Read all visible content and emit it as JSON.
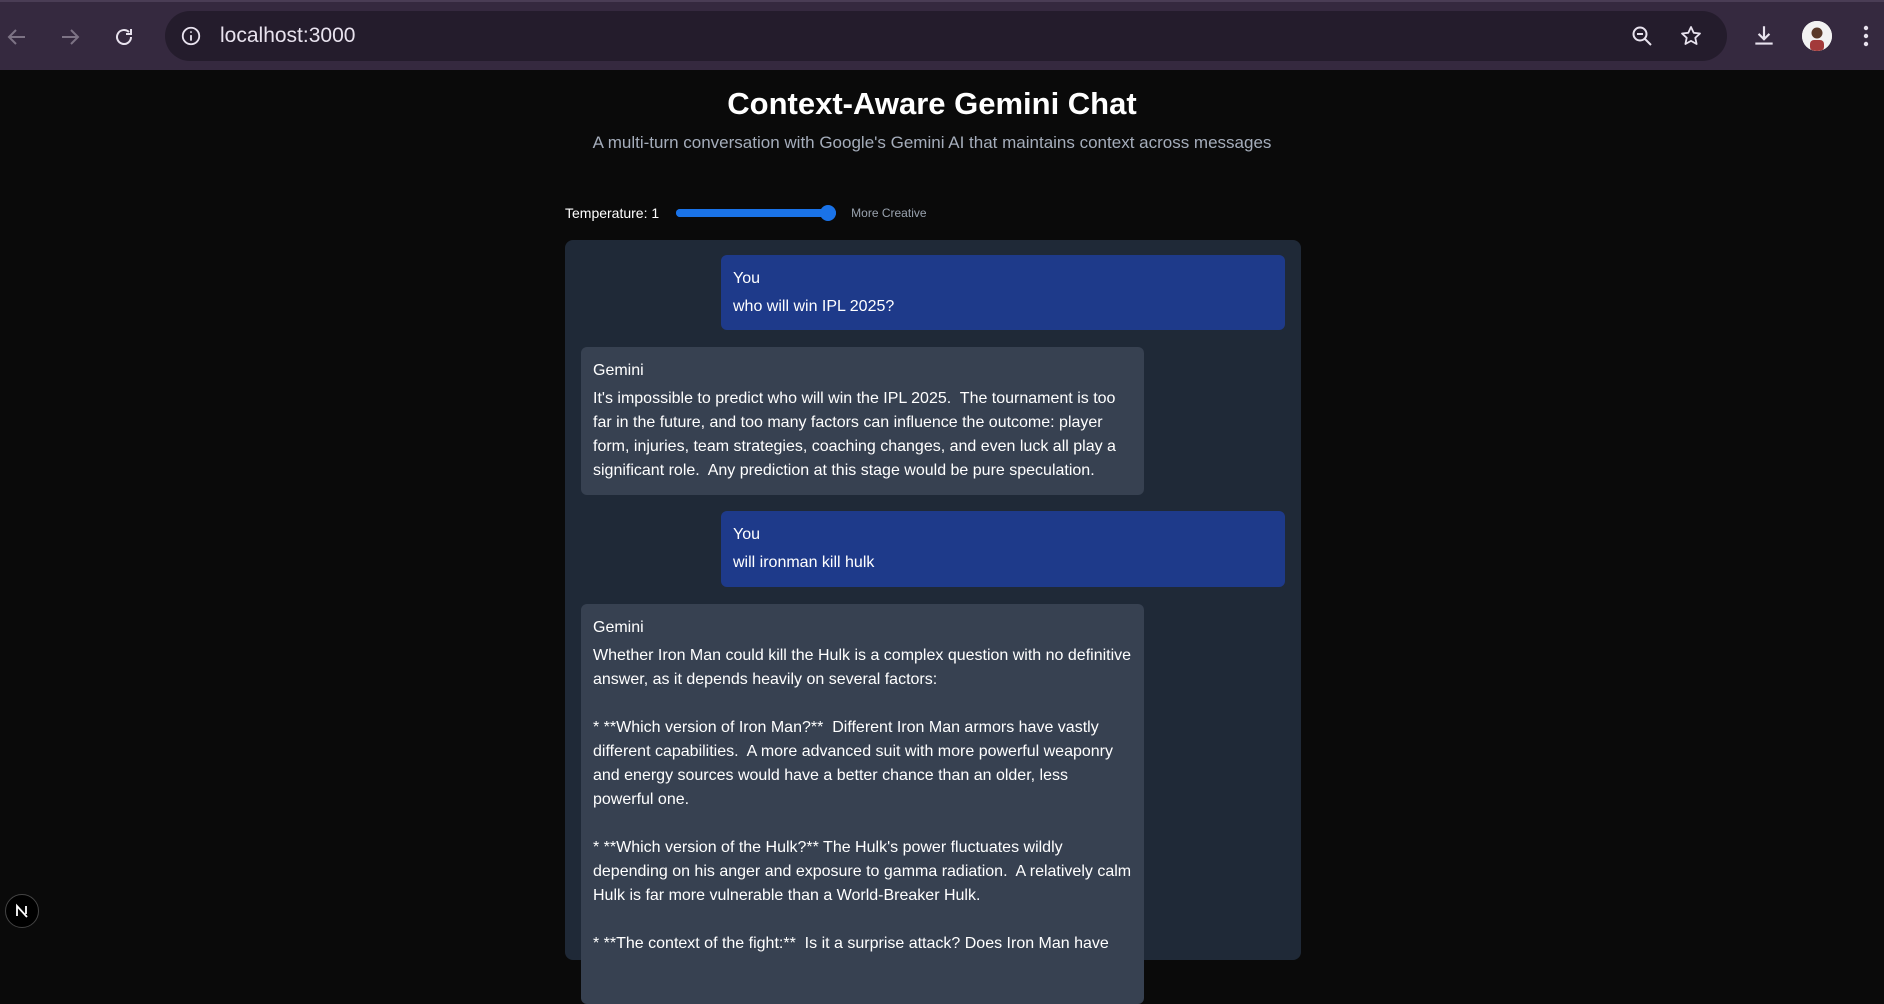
{
  "browser": {
    "url": "localhost:3000",
    "icons": {
      "back": "arrow-left-icon",
      "forward": "arrow-right-icon",
      "reload": "reload-icon",
      "info": "info-icon",
      "zoom": "zoom-out-icon",
      "bookmark": "star-icon",
      "download": "download-icon",
      "menu": "kebab-menu-icon"
    }
  },
  "header": {
    "title": "Context-Aware Gemini Chat",
    "subtitle": "A multi-turn conversation with Google's Gemini AI that maintains context across messages"
  },
  "controls": {
    "temperature_label": "Temperature: 1",
    "temperature_value": 1,
    "temperature_min": 0,
    "temperature_max": 1,
    "hint": "More Creative"
  },
  "messages": [
    {
      "role": "You",
      "text": "who will win IPL 2025?"
    },
    {
      "role": "Gemini",
      "text": "It's impossible to predict who will win the IPL 2025.  The tournament is too far in the future, and too many factors can influence the outcome: player form, injuries, team strategies, coaching changes, and even luck all play a significant role.  Any prediction at this stage would be pure speculation."
    },
    {
      "role": "You",
      "text": "will ironman kill hulk"
    },
    {
      "role": "Gemini",
      "text": "Whether Iron Man could kill the Hulk is a complex question with no definitive answer, as it depends heavily on several factors:\n\n* **Which version of Iron Man?**  Different Iron Man armors have vastly different capabilities.  A more advanced suit with more powerful weaponry and energy sources would have a better chance than an older, less powerful one.\n\n* **Which version of the Hulk?** The Hulk's power fluctuates wildly depending on his anger and exposure to gamma radiation.  A relatively calm Hulk is far more vulnerable than a World-Breaker Hulk.\n\n* **The context of the fight:**  Is it a surprise attack? Does Iron Man have"
    }
  ],
  "colors": {
    "page_bg": "#0a0a0a",
    "chat_bg": "#1f2937",
    "user_bubble": "#1e3a8a",
    "bot_bubble": "#374151",
    "accent": "#1a73e8"
  },
  "badge": {
    "letter": "N"
  }
}
